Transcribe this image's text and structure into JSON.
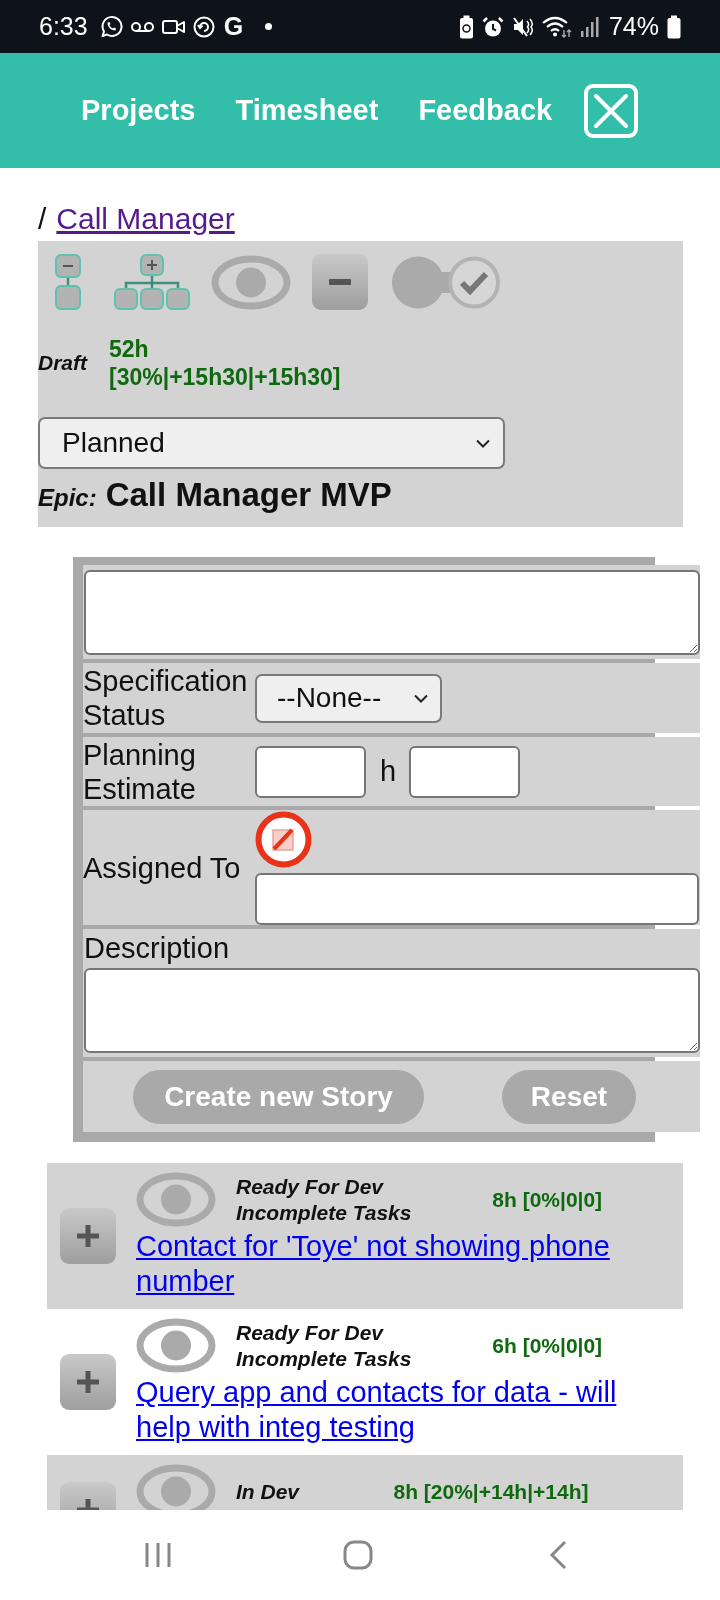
{
  "status_bar": {
    "time": "6:33",
    "notification_letter": "G",
    "battery": "74%"
  },
  "nav": {
    "links": [
      {
        "label": "Projects"
      },
      {
        "label": "Timesheet"
      },
      {
        "label": "Feedback"
      }
    ]
  },
  "breadcrumb": {
    "separator": "/",
    "link": "Call Manager"
  },
  "epic_panel": {
    "status": "Draft",
    "hours": "52h",
    "breakdown": "[30%|+15h30|+15h30]",
    "state": "Planned",
    "type": "Epic:",
    "title": "Call Manager MVP"
  },
  "story_form": {
    "rows": [
      {
        "kind": "textarea"
      },
      {
        "kind": "select",
        "label": "Specification Status",
        "value": "--None--"
      },
      {
        "kind": "estimate",
        "label": "Planning Estimate",
        "unit": "h"
      },
      {
        "kind": "assignee",
        "label": "Assigned To"
      },
      {
        "kind": "description",
        "label": "Description"
      }
    ],
    "buttons": [
      {
        "label": "Create new Story"
      },
      {
        "label": "Reset"
      }
    ]
  },
  "stories": [
    {
      "statuses": [
        "Ready For Dev",
        "Incomplete Tasks"
      ],
      "estimate": "8h [0%|0|0]",
      "title": "Contact for 'Toye' not showing phone number"
    },
    {
      "statuses": [
        "Ready For Dev",
        "Incomplete Tasks"
      ],
      "estimate": "6h [0%|0|0]",
      "title": "Query app and contacts for data - will help with integ testing"
    },
    {
      "statuses": [
        "In Dev"
      ],
      "estimate": "8h [20%|+14h|+14h]"
    }
  ]
}
